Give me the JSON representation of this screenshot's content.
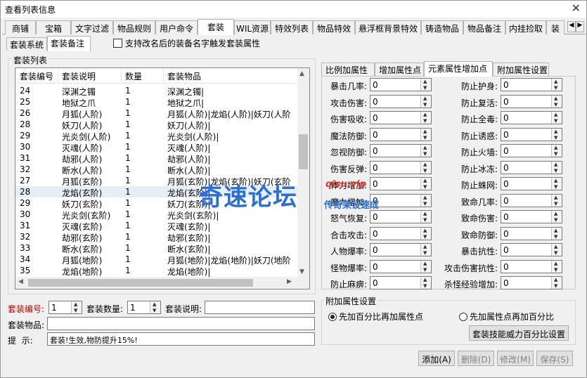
{
  "window": {
    "title": "查看列表信息",
    "close_glyph": "✕"
  },
  "tabs": [
    "商铺",
    "宝箱",
    "文字过滤",
    "物品规则",
    "用户命令",
    "套装",
    "WIL资源",
    "特效列表",
    "物品特效",
    "悬浮框背景特效",
    "铸造物品",
    "物品备注",
    "内挂捡取",
    "装"
  ],
  "active_tab": 5,
  "subtabs": [
    "套装系统",
    "套装备注"
  ],
  "active_subtab": 1,
  "checkbox_label": "支持改名后的装备名字触发套装属性",
  "list_group_title": "套装列表",
  "list": {
    "columns": [
      "套装编号",
      "套装说明",
      "数量",
      "套装物品"
    ],
    "rows": [
      [
        "24",
        "深渊之镯",
        "1",
        "深渊之镯|"
      ],
      [
        "25",
        "地狱之爪",
        "1",
        "地狱之爪|"
      ],
      [
        "26",
        "月狐(人阶)",
        "1",
        "月狐(人阶)|龙焰(人阶)|妖刀(人阶"
      ],
      [
        "28",
        "妖刀(人阶)",
        "1",
        "妖刀(人阶)|"
      ],
      [
        "29",
        "光炎剑(人阶)",
        "1",
        "光炎剑(人阶)|"
      ],
      [
        "30",
        "灭魂(人阶)",
        "1",
        "灭魂(人阶)|"
      ],
      [
        "31",
        "劫邪(人阶)",
        "1",
        "劫邪(人阶)|"
      ],
      [
        "32",
        "断水(人阶)",
        "1",
        "断水(人阶)|"
      ],
      [
        "27",
        "月狐(玄阶)",
        "1",
        "月狐(玄阶)|龙焰(玄阶)|妖刀(玄阶"
      ],
      [
        "28",
        "龙焰(玄阶)",
        "1",
        "龙焰(玄阶)|"
      ],
      [
        "29",
        "妖刀(玄阶)",
        "1",
        "妖刀(玄阶)|"
      ],
      [
        "30",
        "光炎剑(玄阶)",
        "1",
        "光炎剑(玄阶)|"
      ],
      [
        "31",
        "灭魂(玄阶)",
        "1",
        "灭魂(玄阶)|"
      ],
      [
        "32",
        "劫邪(玄阶)",
        "1",
        "劫邪(玄阶)|"
      ],
      [
        "33",
        "断水(玄阶)",
        "1",
        "断水(玄阶)|"
      ],
      [
        "34",
        "月狐(地阶)",
        "1",
        "月狐(地阶)|龙焰(地阶)|妖刀(地阶"
      ],
      [
        "35",
        "龙焰(地阶)",
        "1",
        "龙焰(地阶)|"
      ]
    ],
    "selected_row": 9
  },
  "form": {
    "set_id_label": "套装编号:",
    "set_id_value": "1",
    "set_count_label": "套装数量:",
    "set_count_value": "1",
    "set_desc_label": "套装说明:",
    "set_desc_value": "",
    "set_items_label": "套装物品:",
    "set_items_value": "",
    "hint_label": "提  示:",
    "hint_value": "套装!生效,物防提升15%!"
  },
  "right_tabs": [
    "比例加属性",
    "增加属性点",
    "元素属性增加点",
    "附加属性设置"
  ],
  "active_right_tab": 2,
  "attrs_left": [
    {
      "label": "暴击几率:",
      "value": "0"
    },
    {
      "label": "攻击伤害:",
      "value": "0"
    },
    {
      "label": "伤害吸收:",
      "value": "0"
    },
    {
      "label": "魔法防御:",
      "value": "0"
    },
    {
      "label": "忽视防御:",
      "value": "0"
    },
    {
      "label": "伤害反弹:",
      "value": "0"
    },
    {
      "label": "体力增加:",
      "value": "0"
    },
    {
      "label": "魔力增加:",
      "value": "0"
    },
    {
      "label": "怒气恢复:",
      "value": "0"
    },
    {
      "label": "合击攻击:",
      "value": "0"
    },
    {
      "label": "人物爆率:",
      "value": "0"
    },
    {
      "label": "怪物爆率:",
      "value": "0"
    },
    {
      "label": "防止麻痹:",
      "value": "0"
    }
  ],
  "attrs_right": [
    {
      "label": "防止护身:",
      "value": "0"
    },
    {
      "label": "防止复活:",
      "value": "0"
    },
    {
      "label": "防止全毒:",
      "value": "0"
    },
    {
      "label": "防止诱惑:",
      "value": "0"
    },
    {
      "label": "防止火墙:",
      "value": "0"
    },
    {
      "label": "防止冰冻:",
      "value": "0"
    },
    {
      "label": "防止蛛网:",
      "value": "0"
    },
    {
      "label": "致命几率:",
      "value": "0"
    },
    {
      "label": "致命伤害:",
      "value": "0"
    },
    {
      "label": "致命防御:",
      "value": "0"
    },
    {
      "label": "暴击抗性:",
      "value": "0"
    },
    {
      "label": "攻击伤害抗性:",
      "value": "0"
    },
    {
      "label": "杀怪经验增加:",
      "value": "0"
    }
  ],
  "extra_group": {
    "title": "附加属性设置",
    "radio1": "先加百分比再加属性点",
    "radio2": "先加属性点再加百分比",
    "skill_button": "套装技能威力百分比设置"
  },
  "buttons": {
    "add": "添加(A)",
    "delete": "删除(D)",
    "modify": "修改(M)",
    "save": "保存(S)"
  },
  "watermark": {
    "brand": "奇速论坛",
    "site": "qisu.vip",
    "slogan": "传奇架设速成"
  }
}
